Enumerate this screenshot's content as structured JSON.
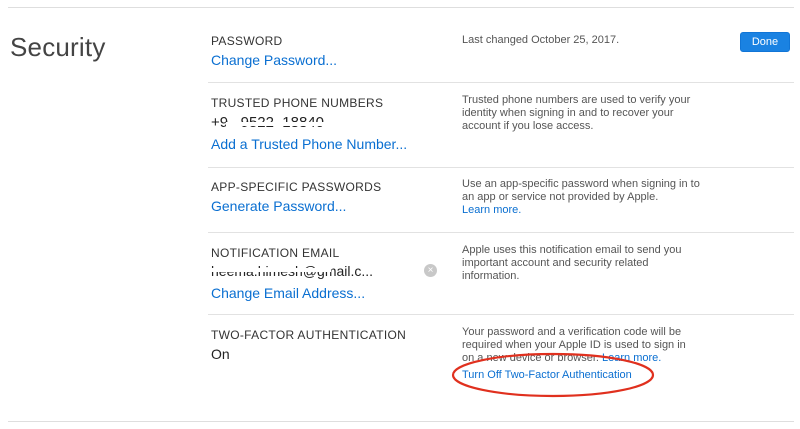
{
  "section": {
    "title": "Security"
  },
  "done_button": {
    "label": "Done"
  },
  "password": {
    "label": "PASSWORD",
    "link": "Change Password...",
    "description": "Last changed October 25, 2017."
  },
  "trusted_phone": {
    "label": "TRUSTED PHONE NUMBERS",
    "value": "+9   9522  18840",
    "link": "Add a Trusted Phone Number...",
    "description": "Trusted phone numbers are used to verify your identity when signing in and to recover your account if you lose access."
  },
  "app_passwords": {
    "label": "APP-SPECIFIC PASSWORDS",
    "link": "Generate Password...",
    "description": "Use an app-specific password when signing in to an app or service not provided by Apple.",
    "learn_more": "Learn more."
  },
  "notification_email": {
    "label": "NOTIFICATION EMAIL",
    "value": "heema.himesh@gmail.c...",
    "link": "Change Email Address...",
    "description": "Apple uses this notification email to send you important account and security related information.",
    "clear_icon": "×"
  },
  "two_factor": {
    "label": "TWO-FACTOR AUTHENTICATION",
    "value": "On",
    "description": "Your password and a verification code will be required when your Apple ID is used to sign in on a new device or browser.",
    "learn_more": "Learn more.",
    "turn_off_link": "Turn Off Two-Factor Authentication"
  },
  "colors": {
    "link": "#0a6fd1",
    "button": "#1a82e2",
    "annotation": "#e0301e"
  }
}
